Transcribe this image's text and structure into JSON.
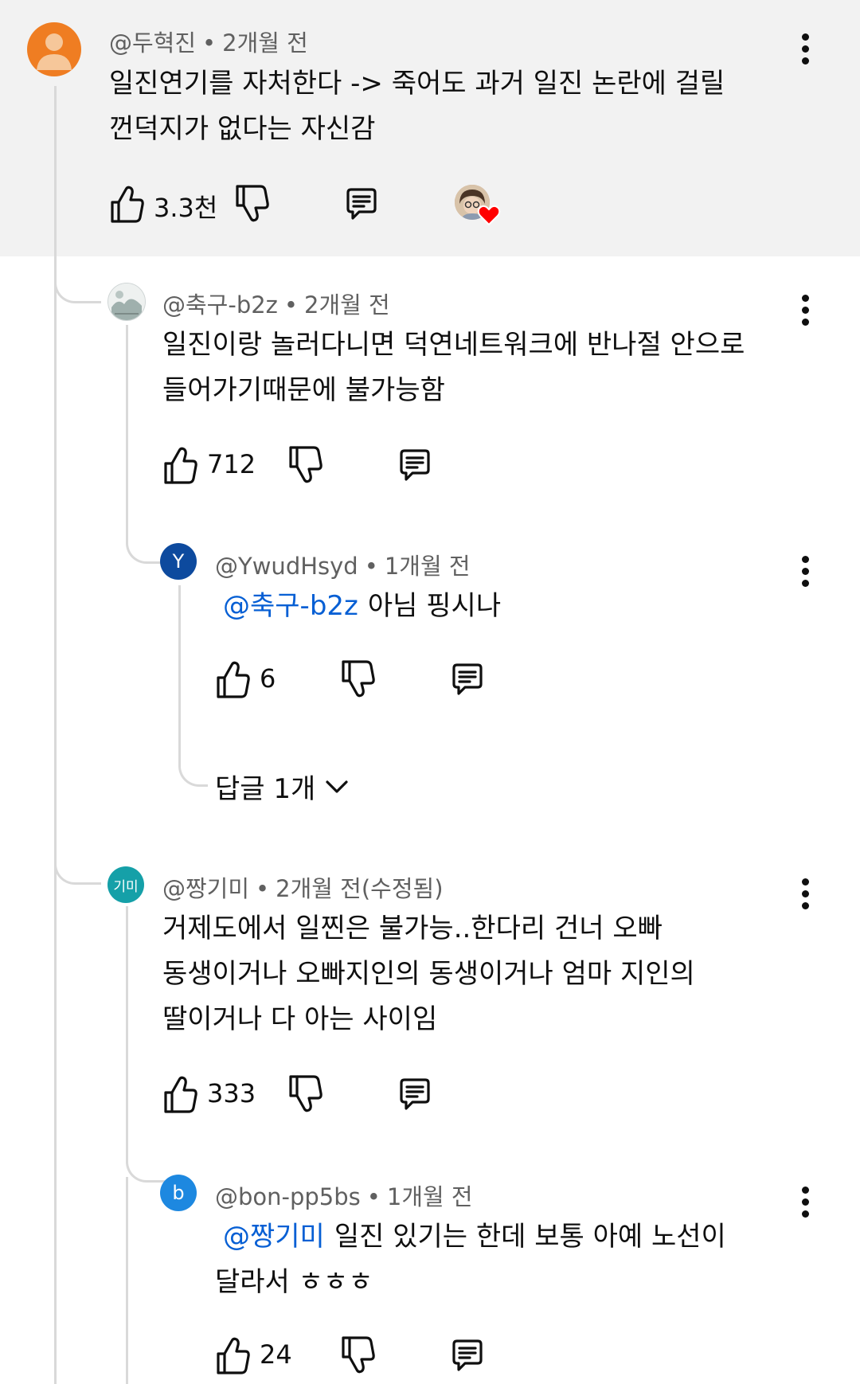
{
  "comments": [
    {
      "author": "@두혁진",
      "time": "2개월 전",
      "text_lines": [
        "일진연기를 자처한다 -> 죽어도 과거 일진 논란에 걸릴",
        "껀덕지가 없다는 자신감"
      ],
      "likes": "3.3천",
      "creator_heart": true,
      "avatar_color": "#ef7d22"
    },
    {
      "author": "@축구-b2z",
      "time": "2개월 전",
      "text_lines": [
        "일진이랑 놀러다니면 덕연네트워크에 반나절 안으로",
        "들어가기때문에 불가능함"
      ],
      "likes": "712"
    },
    {
      "author": "@YwudHsyd",
      "time": "1개월 전",
      "mention": "@축구-b2z",
      "text_lines": [
        "아님 핑시나"
      ],
      "likes": "6",
      "avatar_letter": "Y",
      "avatar_color": "#0d4a9e",
      "replies_link": "답글 1개"
    },
    {
      "author": "@짱기미",
      "time": "2개월 전(수정됨)",
      "text_lines": [
        "거제도에서 일찐은 불가능..한다리 건너 오빠",
        "동생이거나 오빠지인의 동생이거나 엄마 지인의",
        "딸이거나 다 아는 사이임"
      ],
      "likes": "333",
      "avatar_letter": "기미",
      "avatar_color": "#15a0a8"
    },
    {
      "author": "@bon-pp5bs",
      "time": "1개월 전",
      "mention": "@짱기미",
      "text_lines": [
        "일진 있기는 한데 보통 아예 노선이",
        "달라서 ㅎㅎㅎ"
      ],
      "likes": "24",
      "avatar_letter": "b",
      "avatar_color": "#1d88e0"
    }
  ],
  "colors": {
    "highlight_bg": "#f2f2f2",
    "mention": "#065fd4",
    "meta": "#606060",
    "heart": "#ff0000",
    "thread_line": "#d9d9d9"
  },
  "icons": {
    "like": "thumbs-up-icon",
    "dislike": "thumbs-down-icon",
    "reply": "reply-comment-icon",
    "more": "more-vertical-icon",
    "expand": "chevron-down-icon",
    "creator_heart": "creator-heart-icon"
  }
}
